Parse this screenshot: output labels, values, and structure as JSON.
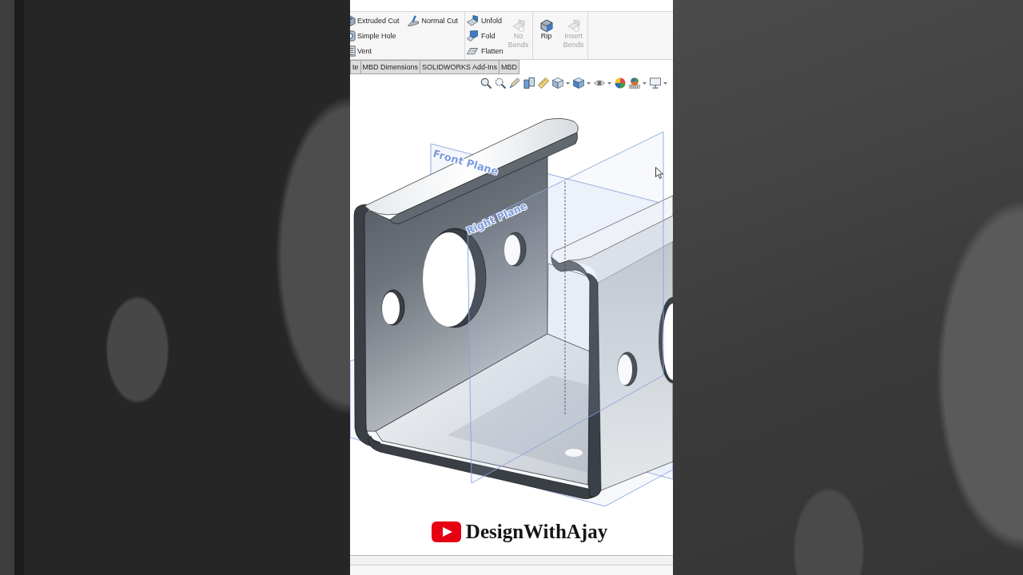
{
  "ribbon": {
    "groups": [
      {
        "columns": [
          [
            {
              "label": "Extruded Cut",
              "kind": "small",
              "disabled": false
            },
            {
              "label": "Simple Hole",
              "kind": "small",
              "disabled": false
            },
            {
              "label": "Vent",
              "kind": "small",
              "disabled": false
            }
          ],
          [
            {
              "label": "Normal Cut",
              "kind": "small",
              "disabled": false
            }
          ]
        ]
      },
      {
        "columns": [
          [
            {
              "label": "Unfold",
              "kind": "small",
              "disabled": false
            },
            {
              "label": "Fold",
              "kind": "small",
              "disabled": false
            },
            {
              "label": "Flatten",
              "kind": "small",
              "disabled": false
            }
          ],
          [
            {
              "label": "No Bends",
              "kind": "large",
              "disabled": true
            }
          ]
        ]
      },
      {
        "columns": [
          [
            {
              "label": "Rip",
              "kind": "large",
              "disabled": false
            }
          ],
          [
            {
              "label": "Insert Bends",
              "kind": "large",
              "disabled": true
            }
          ]
        ]
      }
    ]
  },
  "tabs": [
    {
      "label": "te"
    },
    {
      "label": "MBD Dimensions"
    },
    {
      "label": "SOLIDWORKS Add-Ins"
    },
    {
      "label": "MBD"
    }
  ],
  "viewport": {
    "planes": [
      {
        "label": "Front Plane"
      },
      {
        "label": "Right Plane"
      }
    ]
  },
  "branding": {
    "channel_name": "DesignWithAjay"
  }
}
